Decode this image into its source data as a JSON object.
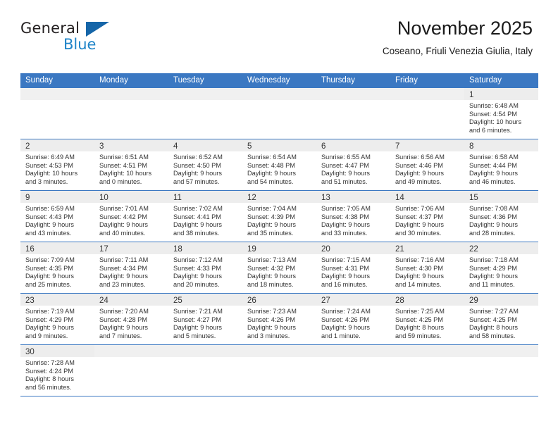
{
  "brand": {
    "name_top": "General",
    "name_bottom": "Blue",
    "logo_icon": "triangle-logo-icon",
    "color_black": "#231f20",
    "color_blue": "#1f84c8"
  },
  "header": {
    "title": "November 2025",
    "subtitle": "Coseano, Friuli Venezia Giulia, Italy"
  },
  "theme": {
    "header_blue": "#3b78c2",
    "day_band_gray": "#ededed",
    "text": "#333333"
  },
  "weekdays": [
    "Sunday",
    "Monday",
    "Tuesday",
    "Wednesday",
    "Thursday",
    "Friday",
    "Saturday"
  ],
  "labels": {
    "sunrise": "Sunrise:",
    "sunset": "Sunset:",
    "daylight": "Daylight:"
  },
  "weeks": [
    [
      {
        "day": "",
        "empty": true
      },
      {
        "day": "",
        "empty": true
      },
      {
        "day": "",
        "empty": true
      },
      {
        "day": "",
        "empty": true
      },
      {
        "day": "",
        "empty": true
      },
      {
        "day": "",
        "empty": true
      },
      {
        "day": "1",
        "sunrise": "Sunrise: 6:48 AM",
        "sunset": "Sunset: 4:54 PM",
        "daylight_1": "Daylight: 10 hours",
        "daylight_2": "and 6 minutes."
      }
    ],
    [
      {
        "day": "2",
        "sunrise": "Sunrise: 6:49 AM",
        "sunset": "Sunset: 4:53 PM",
        "daylight_1": "Daylight: 10 hours",
        "daylight_2": "and 3 minutes."
      },
      {
        "day": "3",
        "sunrise": "Sunrise: 6:51 AM",
        "sunset": "Sunset: 4:51 PM",
        "daylight_1": "Daylight: 10 hours",
        "daylight_2": "and 0 minutes."
      },
      {
        "day": "4",
        "sunrise": "Sunrise: 6:52 AM",
        "sunset": "Sunset: 4:50 PM",
        "daylight_1": "Daylight: 9 hours",
        "daylight_2": "and 57 minutes."
      },
      {
        "day": "5",
        "sunrise": "Sunrise: 6:54 AM",
        "sunset": "Sunset: 4:48 PM",
        "daylight_1": "Daylight: 9 hours",
        "daylight_2": "and 54 minutes."
      },
      {
        "day": "6",
        "sunrise": "Sunrise: 6:55 AM",
        "sunset": "Sunset: 4:47 PM",
        "daylight_1": "Daylight: 9 hours",
        "daylight_2": "and 51 minutes."
      },
      {
        "day": "7",
        "sunrise": "Sunrise: 6:56 AM",
        "sunset": "Sunset: 4:46 PM",
        "daylight_1": "Daylight: 9 hours",
        "daylight_2": "and 49 minutes."
      },
      {
        "day": "8",
        "sunrise": "Sunrise: 6:58 AM",
        "sunset": "Sunset: 4:44 PM",
        "daylight_1": "Daylight: 9 hours",
        "daylight_2": "and 46 minutes."
      }
    ],
    [
      {
        "day": "9",
        "sunrise": "Sunrise: 6:59 AM",
        "sunset": "Sunset: 4:43 PM",
        "daylight_1": "Daylight: 9 hours",
        "daylight_2": "and 43 minutes."
      },
      {
        "day": "10",
        "sunrise": "Sunrise: 7:01 AM",
        "sunset": "Sunset: 4:42 PM",
        "daylight_1": "Daylight: 9 hours",
        "daylight_2": "and 40 minutes."
      },
      {
        "day": "11",
        "sunrise": "Sunrise: 7:02 AM",
        "sunset": "Sunset: 4:41 PM",
        "daylight_1": "Daylight: 9 hours",
        "daylight_2": "and 38 minutes."
      },
      {
        "day": "12",
        "sunrise": "Sunrise: 7:04 AM",
        "sunset": "Sunset: 4:39 PM",
        "daylight_1": "Daylight: 9 hours",
        "daylight_2": "and 35 minutes."
      },
      {
        "day": "13",
        "sunrise": "Sunrise: 7:05 AM",
        "sunset": "Sunset: 4:38 PM",
        "daylight_1": "Daylight: 9 hours",
        "daylight_2": "and 33 minutes."
      },
      {
        "day": "14",
        "sunrise": "Sunrise: 7:06 AM",
        "sunset": "Sunset: 4:37 PM",
        "daylight_1": "Daylight: 9 hours",
        "daylight_2": "and 30 minutes."
      },
      {
        "day": "15",
        "sunrise": "Sunrise: 7:08 AM",
        "sunset": "Sunset: 4:36 PM",
        "daylight_1": "Daylight: 9 hours",
        "daylight_2": "and 28 minutes."
      }
    ],
    [
      {
        "day": "16",
        "sunrise": "Sunrise: 7:09 AM",
        "sunset": "Sunset: 4:35 PM",
        "daylight_1": "Daylight: 9 hours",
        "daylight_2": "and 25 minutes."
      },
      {
        "day": "17",
        "sunrise": "Sunrise: 7:11 AM",
        "sunset": "Sunset: 4:34 PM",
        "daylight_1": "Daylight: 9 hours",
        "daylight_2": "and 23 minutes."
      },
      {
        "day": "18",
        "sunrise": "Sunrise: 7:12 AM",
        "sunset": "Sunset: 4:33 PM",
        "daylight_1": "Daylight: 9 hours",
        "daylight_2": "and 20 minutes."
      },
      {
        "day": "19",
        "sunrise": "Sunrise: 7:13 AM",
        "sunset": "Sunset: 4:32 PM",
        "daylight_1": "Daylight: 9 hours",
        "daylight_2": "and 18 minutes."
      },
      {
        "day": "20",
        "sunrise": "Sunrise: 7:15 AM",
        "sunset": "Sunset: 4:31 PM",
        "daylight_1": "Daylight: 9 hours",
        "daylight_2": "and 16 minutes."
      },
      {
        "day": "21",
        "sunrise": "Sunrise: 7:16 AM",
        "sunset": "Sunset: 4:30 PM",
        "daylight_1": "Daylight: 9 hours",
        "daylight_2": "and 14 minutes."
      },
      {
        "day": "22",
        "sunrise": "Sunrise: 7:18 AM",
        "sunset": "Sunset: 4:29 PM",
        "daylight_1": "Daylight: 9 hours",
        "daylight_2": "and 11 minutes."
      }
    ],
    [
      {
        "day": "23",
        "sunrise": "Sunrise: 7:19 AM",
        "sunset": "Sunset: 4:29 PM",
        "daylight_1": "Daylight: 9 hours",
        "daylight_2": "and 9 minutes."
      },
      {
        "day": "24",
        "sunrise": "Sunrise: 7:20 AM",
        "sunset": "Sunset: 4:28 PM",
        "daylight_1": "Daylight: 9 hours",
        "daylight_2": "and 7 minutes."
      },
      {
        "day": "25",
        "sunrise": "Sunrise: 7:21 AM",
        "sunset": "Sunset: 4:27 PM",
        "daylight_1": "Daylight: 9 hours",
        "daylight_2": "and 5 minutes."
      },
      {
        "day": "26",
        "sunrise": "Sunrise: 7:23 AM",
        "sunset": "Sunset: 4:26 PM",
        "daylight_1": "Daylight: 9 hours",
        "daylight_2": "and 3 minutes."
      },
      {
        "day": "27",
        "sunrise": "Sunrise: 7:24 AM",
        "sunset": "Sunset: 4:26 PM",
        "daylight_1": "Daylight: 9 hours",
        "daylight_2": "and 1 minute."
      },
      {
        "day": "28",
        "sunrise": "Sunrise: 7:25 AM",
        "sunset": "Sunset: 4:25 PM",
        "daylight_1": "Daylight: 8 hours",
        "daylight_2": "and 59 minutes."
      },
      {
        "day": "29",
        "sunrise": "Sunrise: 7:27 AM",
        "sunset": "Sunset: 4:25 PM",
        "daylight_1": "Daylight: 8 hours",
        "daylight_2": "and 58 minutes."
      }
    ],
    [
      {
        "day": "30",
        "sunrise": "Sunrise: 7:28 AM",
        "sunset": "Sunset: 4:24 PM",
        "daylight_1": "Daylight: 8 hours",
        "daylight_2": "and 56 minutes."
      },
      {
        "day": "",
        "empty": true
      },
      {
        "day": "",
        "empty": true
      },
      {
        "day": "",
        "empty": true
      },
      {
        "day": "",
        "empty": true
      },
      {
        "day": "",
        "empty": true
      },
      {
        "day": "",
        "empty": true
      }
    ]
  ]
}
